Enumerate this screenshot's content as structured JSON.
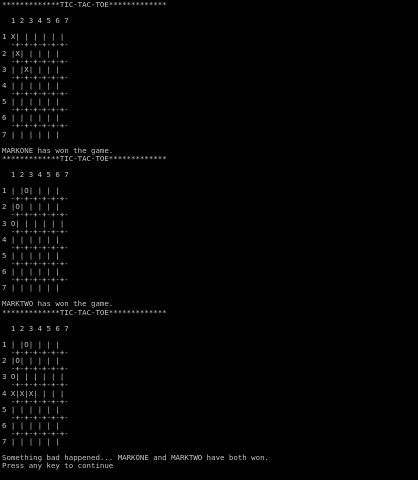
{
  "colors": {
    "background": "#000000",
    "text": "#c0c0c0"
  },
  "console": {
    "lines": [
      "*************TIC-TAC-TOE*************",
      "",
      "  1 2 3 4 5 6 7",
      "",
      "1 X| | | | | | ",
      "  -+-+-+-+-+-+-",
      "2 |X| | | | | ",
      "  -+-+-+-+-+-+-",
      "3 | |X| | | | ",
      "  -+-+-+-+-+-+-",
      "4 | | | | | | ",
      "  -+-+-+-+-+-+-",
      "5 | | | | | | ",
      "  -+-+-+-+-+-+-",
      "6 | | | | | | ",
      "  -+-+-+-+-+-+-",
      "7 | | | | | | ",
      "",
      "MARKONE has won the game.",
      "*************TIC-TAC-TOE*************",
      "",
      "  1 2 3 4 5 6 7",
      "",
      "1 | |O| | | | ",
      "  -+-+-+-+-+-+-",
      "2 |O| | | | | ",
      "  -+-+-+-+-+-+-",
      "3 O| | | | | | ",
      "  -+-+-+-+-+-+-",
      "4 | | | | | | ",
      "  -+-+-+-+-+-+-",
      "5 | | | | | | ",
      "  -+-+-+-+-+-+-",
      "6 | | | | | | ",
      "  -+-+-+-+-+-+-",
      "7 | | | | | | ",
      "",
      "MARKTWO has won the game.",
      "*************TIC-TAC-TOE*************",
      "",
      "  1 2 3 4 5 6 7",
      "",
      "1 | |O| | | | ",
      "  -+-+-+-+-+-+-",
      "2 |O| | | | | ",
      "  -+-+-+-+-+-+-",
      "3 O| | | | | | ",
      "  -+-+-+-+-+-+-",
      "4 X|X|X| | | | ",
      "  -+-+-+-+-+-+-",
      "5 | | | | | | ",
      "  -+-+-+-+-+-+-",
      "6 | | | | | | ",
      "  -+-+-+-+-+-+-",
      "7 | | | | | | ",
      "",
      "Something bad happened... MARKONE and MARKTWO have both won.",
      "Press any key to continue"
    ]
  }
}
